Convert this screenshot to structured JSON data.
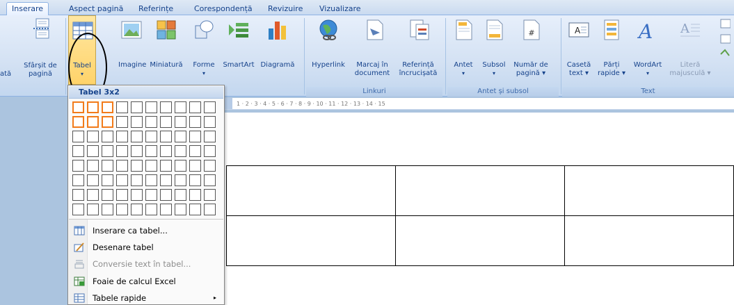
{
  "tabs": [
    {
      "label": "Inserare",
      "active": true
    },
    {
      "label": "Aspect pagină"
    },
    {
      "label": "Referințe"
    },
    {
      "label": "Corespondență"
    },
    {
      "label": "Revizuire"
    },
    {
      "label": "Vizualizare"
    }
  ],
  "ribbon": {
    "page_break": {
      "l1": "Sfârșit de",
      "l2": "pagină",
      "cut": "ată"
    },
    "table_btn": {
      "label": "Tabel",
      "arrow": "▾"
    },
    "image": "Imagine",
    "thumbnail": "Miniatură",
    "shapes": {
      "label": "Forme",
      "arrow": "▾"
    },
    "smartart": "SmartArt",
    "diagram": "Diagramă",
    "hyperlink": "Hyperlink",
    "bookmark": {
      "l1": "Marcaj în",
      "l2": "document"
    },
    "crossref": {
      "l1": "Referință",
      "l2": "încrucișată"
    },
    "links_caption": "Linkuri",
    "header": {
      "label": "Antet",
      "arrow": "▾"
    },
    "footer": {
      "label": "Subsol",
      "arrow": "▾"
    },
    "page_number": {
      "l1": "Număr de",
      "l2": "pagină ▾"
    },
    "hf_caption": "Antet și subsol",
    "textbox": {
      "l1": "Casetă",
      "l2": "text ▾"
    },
    "quickparts": {
      "l1": "Părți",
      "l2": "rapide ▾"
    },
    "wordart": {
      "label": "WordArt",
      "arrow": "▾"
    },
    "dropcap": {
      "l1": "Literă",
      "l2": "majusculă ▾"
    },
    "text_caption": "Text"
  },
  "menu": {
    "title": "Tabel 3x2",
    "grid": {
      "cols": 10,
      "rows": 8,
      "sel_cols": 3,
      "sel_rows": 2
    },
    "items": [
      {
        "label": "Inserare ca tabel...",
        "icon": "insert-table-icon"
      },
      {
        "label": "Desenare tabel",
        "icon": "draw-table-icon"
      },
      {
        "label": "Conversie text în tabel...",
        "icon": "convert-text-icon",
        "disabled": true
      },
      {
        "label": "Foaie de calcul Excel",
        "icon": "excel-sheet-icon"
      },
      {
        "label": "Tabele rapide",
        "icon": "quick-tables-icon",
        "submenu": "▸"
      }
    ]
  },
  "ruler": {
    "marks": "1 · 2 · 3 · 4 · 5 · 6 · 7 · 8 · 9 · 10 · 11 · 12 · 13 · 14 · 15"
  },
  "doc_table": {
    "rows": 2,
    "cols": 3
  },
  "colors": {
    "ribbon_text": "#15428b",
    "selection": "#f27b1a",
    "ribbon_bg": "#d3e1f3"
  }
}
